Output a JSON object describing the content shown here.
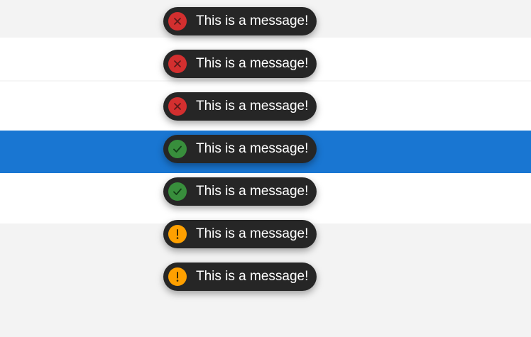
{
  "toasts": [
    {
      "type": "error",
      "icon": "close-circle-icon",
      "message": "This is a message!"
    },
    {
      "type": "error",
      "icon": "close-circle-icon",
      "message": "This is a message!"
    },
    {
      "type": "error",
      "icon": "close-circle-icon",
      "message": "This is a message!"
    },
    {
      "type": "success",
      "icon": "check-circle-icon",
      "message": "This is a message!"
    },
    {
      "type": "success",
      "icon": "check-circle-icon",
      "message": "This is a message!"
    },
    {
      "type": "warning",
      "icon": "exclamation-circle-icon",
      "message": "This is a message!"
    },
    {
      "type": "warning",
      "icon": "exclamation-circle-icon",
      "message": "This is a message!"
    }
  ],
  "colors": {
    "page_background": "#f3f3f3",
    "band_white": "#ffffff",
    "band_blue": "#1976d2",
    "toast_background": "#262626",
    "error": "#d32f2f",
    "success": "#388e3c",
    "warning": "#ffa000"
  }
}
